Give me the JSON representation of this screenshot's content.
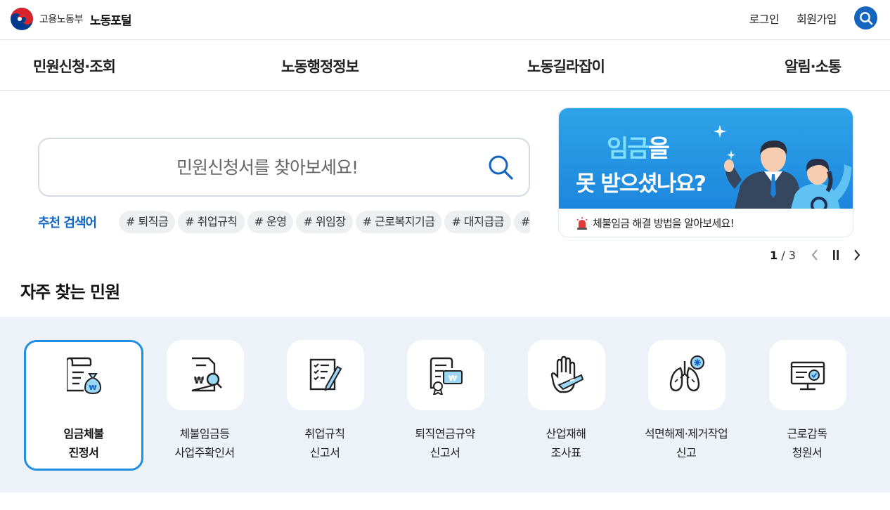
{
  "header": {
    "ministry": "고용노동부",
    "portal": "노동포털",
    "links": [
      "로그인",
      "회원가입"
    ]
  },
  "gnb": [
    "민원신청·조회",
    "노동행정정보",
    "노동길라잡이",
    "알림·소통"
  ],
  "search": {
    "placeholder": "민원신청서를 찾아보세요!",
    "recommend_title": "추천 검색어",
    "tags": [
      "# 퇴직금",
      "# 취업규칙",
      "# 운영",
      "# 위임장",
      "# 근로복지기금",
      "# 대지급금",
      "#"
    ]
  },
  "banner": {
    "line1_highlight": "임금",
    "line1_rest": "을",
    "line2": "못 받으셨나요?",
    "caption": "체불임금 해결 방법을 알아보세요!",
    "pager": {
      "current": "1",
      "separator": "/",
      "total": "3"
    }
  },
  "frequent": {
    "title": "자주 찾는 민원",
    "items": [
      {
        "line1": "임금체불",
        "line2": "진정서",
        "icon": "wage-arrears-document-icon"
      },
      {
        "line1": "체불임금등",
        "line2": "사업주확인서",
        "icon": "document-search-icon"
      },
      {
        "line1": "취업규칙",
        "line2": "신고서",
        "icon": "checklist-pen-icon"
      },
      {
        "line1": "퇴직연금규약",
        "line2": "신고서",
        "icon": "pension-certificate-icon"
      },
      {
        "line1": "산업재해",
        "line2": "조사표",
        "icon": "injured-hand-icon"
      },
      {
        "line1": "석면해제·제거작업",
        "line2": "신고",
        "icon": "lungs-icon"
      },
      {
        "line1": "근로감독",
        "line2": "청원서",
        "icon": "monitor-check-icon"
      }
    ]
  },
  "colors": {
    "primary": "#1465c0",
    "accent": "#1e8fe4",
    "section_bg": "#edf2f9"
  }
}
